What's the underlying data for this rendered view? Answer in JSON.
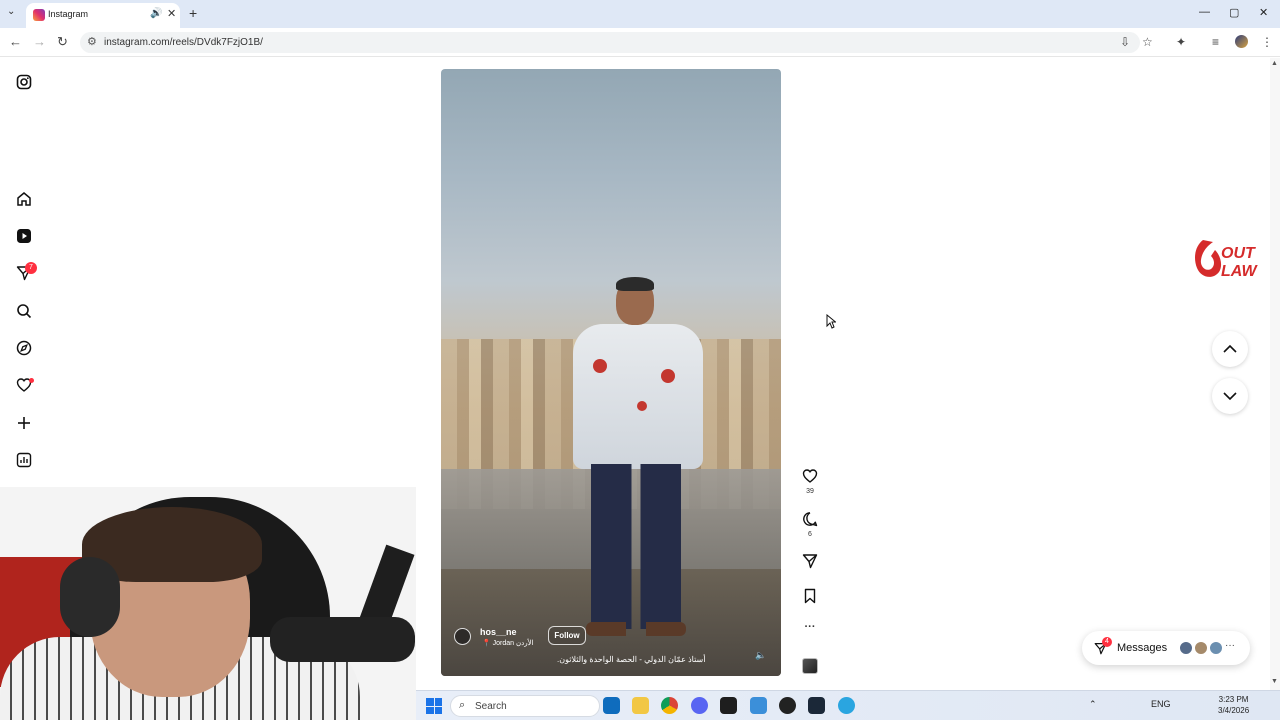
{
  "browser": {
    "tab_title": "Instagram",
    "url": "instagram.com/reels/DVdk7FzjO1B/",
    "new_tab_label": "+",
    "tab_close": "✕",
    "audio": "🔊",
    "tab_list": "⌄",
    "window": {
      "minimize": "—",
      "maximize": "▢",
      "close": "✕"
    },
    "nav": {
      "back": "←",
      "forward": "→",
      "reload": "↻",
      "site_info": "⚙"
    },
    "toolbar_icons": {
      "install": "⇩",
      "bookmark": "☆",
      "extensions": "✦",
      "media": "≡",
      "menu": "⋮"
    }
  },
  "sidebar": {
    "notifications_badge": "7"
  },
  "reel": {
    "username": "hos__ne",
    "location": "📍 Jordan الأردن",
    "follow_label": "Follow",
    "caption": "أستاذ عمّان الدولي - الحصة الواحدة والثلاثون.",
    "mute_icon": "🔈"
  },
  "actions": {
    "likes": "39",
    "comments": "6",
    "more": "···"
  },
  "logo_text": {
    "line1": "OUT",
    "line2": "LAW"
  },
  "messages": {
    "label": "Messages",
    "badge": "4",
    "more": "···"
  },
  "scrollbar": {
    "up": "▲",
    "down": "▼"
  },
  "taskbar": {
    "search_placeholder": "Search",
    "search_icon": "⌕",
    "tray": {
      "chevron": "⌃",
      "lang": "ENG"
    },
    "time": "3:23 PM",
    "date": "3/4/2026"
  },
  "colors": {
    "badge": "#ff3040",
    "outlaw_red": "#d52b2b",
    "windows_blue": "#1a73e8"
  }
}
